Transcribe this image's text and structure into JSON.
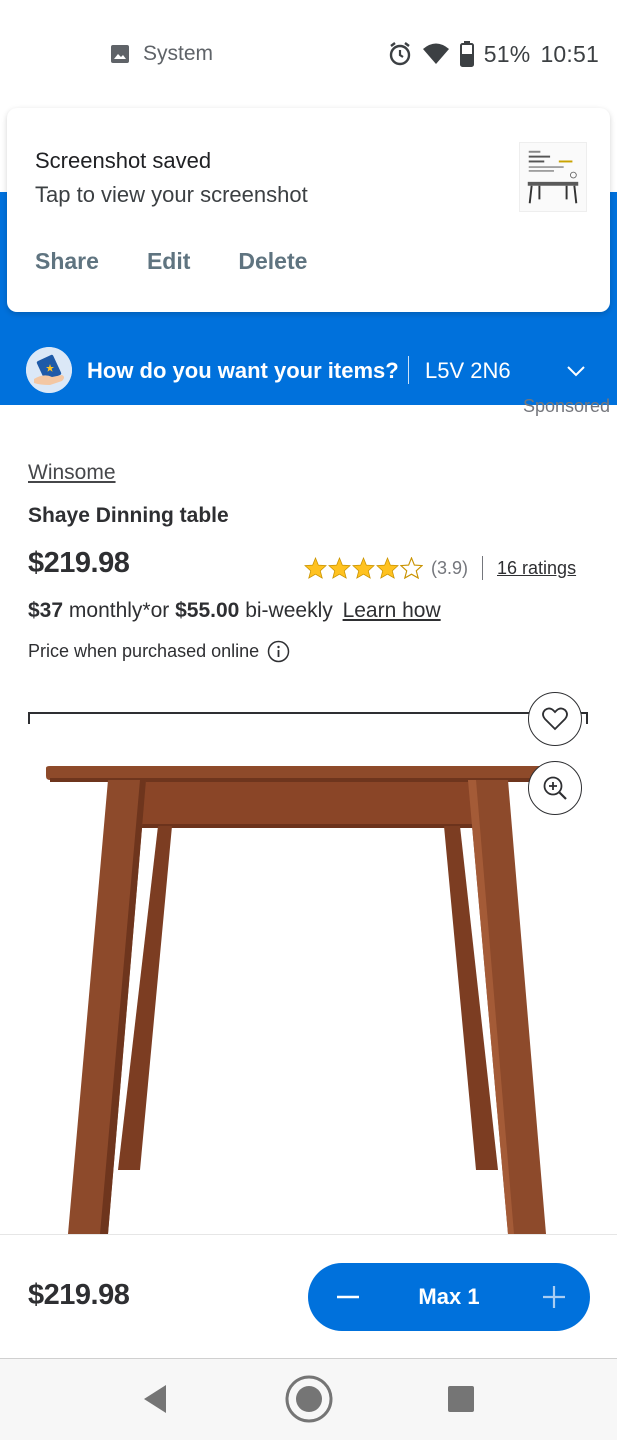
{
  "status_bar": {
    "app_name": "System",
    "battery": "51%",
    "time": "10:51",
    "icons": [
      "image-icon",
      "alarm-icon",
      "wifi-icon",
      "battery-icon"
    ]
  },
  "notification": {
    "title": "Screenshot saved",
    "subtitle": "Tap to view your screenshot",
    "actions": [
      "Share",
      "Edit",
      "Delete"
    ]
  },
  "location_bar": {
    "question": "How do you want your items?",
    "postal_code": "L5V 2N6"
  },
  "sponsored_label": "Sponsored",
  "product": {
    "brand": "Winsome",
    "title": "Shaye Dinning table",
    "price": "$219.98",
    "rating_value": 3.9,
    "rating_display": "(3.9)",
    "rating_count_label": "16 ratings",
    "monthly_amount": "$37",
    "monthly_text": "monthly*or",
    "biweekly_amount": "$55.00",
    "biweekly_text": "bi-weekly",
    "learn_link": "Learn how",
    "online_note": "Price when purchased online"
  },
  "bottom_bar": {
    "price": "$219.98",
    "qty_label": "Max 1"
  },
  "colors": {
    "brand_blue": "#0071dc",
    "star_yellow": "#ffc220",
    "text_dark": "#2e2f32",
    "wood": "#8a4a2c"
  }
}
